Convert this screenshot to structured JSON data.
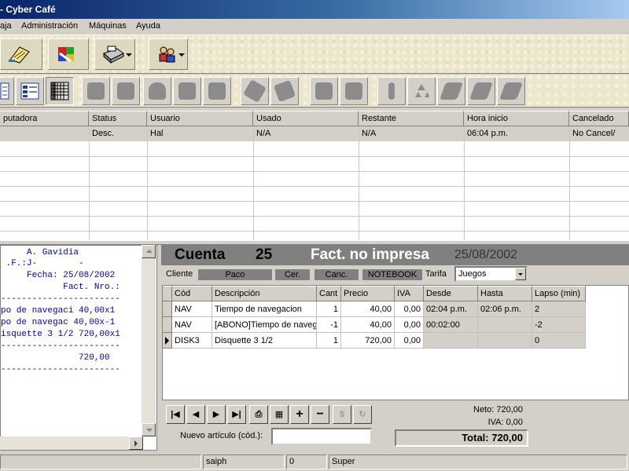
{
  "window": {
    "title": "- Cyber Café"
  },
  "menu": [
    {
      "label": "aja"
    },
    {
      "label": "Administración"
    },
    {
      "label": "Máquinas"
    },
    {
      "label": "Ayuda"
    }
  ],
  "toolbar1": {
    "buttons": [
      {
        "icon": "notepad-icon"
      },
      {
        "icon": "cube-icon"
      },
      {
        "icon": "printer-icon"
      },
      {
        "icon": "users-icon"
      }
    ]
  },
  "toolbar2": {
    "buttons": [
      "list-view-icon",
      "details-view-icon",
      "grid-view-icon",
      "lock-icon",
      "lock-dollar-icon",
      "shield-icon",
      "padlock-icon",
      "tools-icon",
      "broom-icon",
      "sweep-icon",
      "machines-icon",
      "machines-alt-icon",
      "alert-icon",
      "recycle-icon",
      "eraser-icon",
      "erase-all-icon",
      "eraser-alt-icon"
    ]
  },
  "machines_grid": {
    "columns": [
      "putadora",
      "Status",
      "Usuario",
      "Usado",
      "Restante",
      "Hora inicio",
      "Cancelado"
    ],
    "rows": [
      [
        "",
        "Desc.",
        "Hal",
        "N/A",
        "N/A",
        "06:04 p.m.",
        "No Cancel/"
      ]
    ]
  },
  "receipt": {
    "lines": [
      "     A. Gavidia",
      " .F.:J-        -",
      "     Fecha: 25/08/2002",
      "            Fact. Nro.:",
      "-----------------------",
      "po de navegaci 40,00x1",
      "po de navegac 40,00x-1",
      "isquette 3 1/2 720,00x1",
      "-----------------------",
      "               720,00",
      "-----------------------"
    ]
  },
  "cuenta": {
    "label": "Cuenta",
    "number": "25",
    "status": "Fact. no impresa",
    "date": "25/08/2002",
    "cliente_label": "Cliente",
    "cliente": "Paco",
    "cer": "Cer.",
    "canc": "Canc.",
    "machine": "NOTEBOOK",
    "tarifa_label": "Tarifa",
    "tarifa": "Juegos"
  },
  "items_grid": {
    "columns": [
      "Cód",
      "Descripción",
      "Cant",
      "Precio",
      "IVA",
      "Desde",
      "Hasta",
      "Lapso (min)"
    ],
    "rows": [
      [
        "NAV",
        "Tiempo de navegacion",
        "1",
        "40,00",
        "0,00",
        "02:04 p.m.",
        "02:06 p.m.",
        "2"
      ],
      [
        "NAV",
        "[ABONO]Tiempo de naveg",
        "-1",
        "40,00",
        "0,00",
        "00:02:00",
        "",
        "-2"
      ],
      [
        "DISK3",
        "Disquette 3 1/2",
        "1",
        "720,00",
        "0,00",
        "",
        "",
        "0"
      ]
    ]
  },
  "footer": {
    "nuevo_label": "Nuevo artículo (cód.):",
    "nuevo_value": "",
    "neto": "Neto: 720,00",
    "iva": "IVA: 0,00",
    "total": "Total: 720,00",
    "nav_buttons": [
      "first-icon",
      "prev-icon",
      "next-icon",
      "last-icon",
      "print-icon",
      "calendar-icon",
      "add-icon",
      "remove-icon",
      "dollar-icon",
      "refresh-icon"
    ]
  },
  "status": {
    "user": "saiph",
    "count": "0",
    "role": "Super"
  }
}
